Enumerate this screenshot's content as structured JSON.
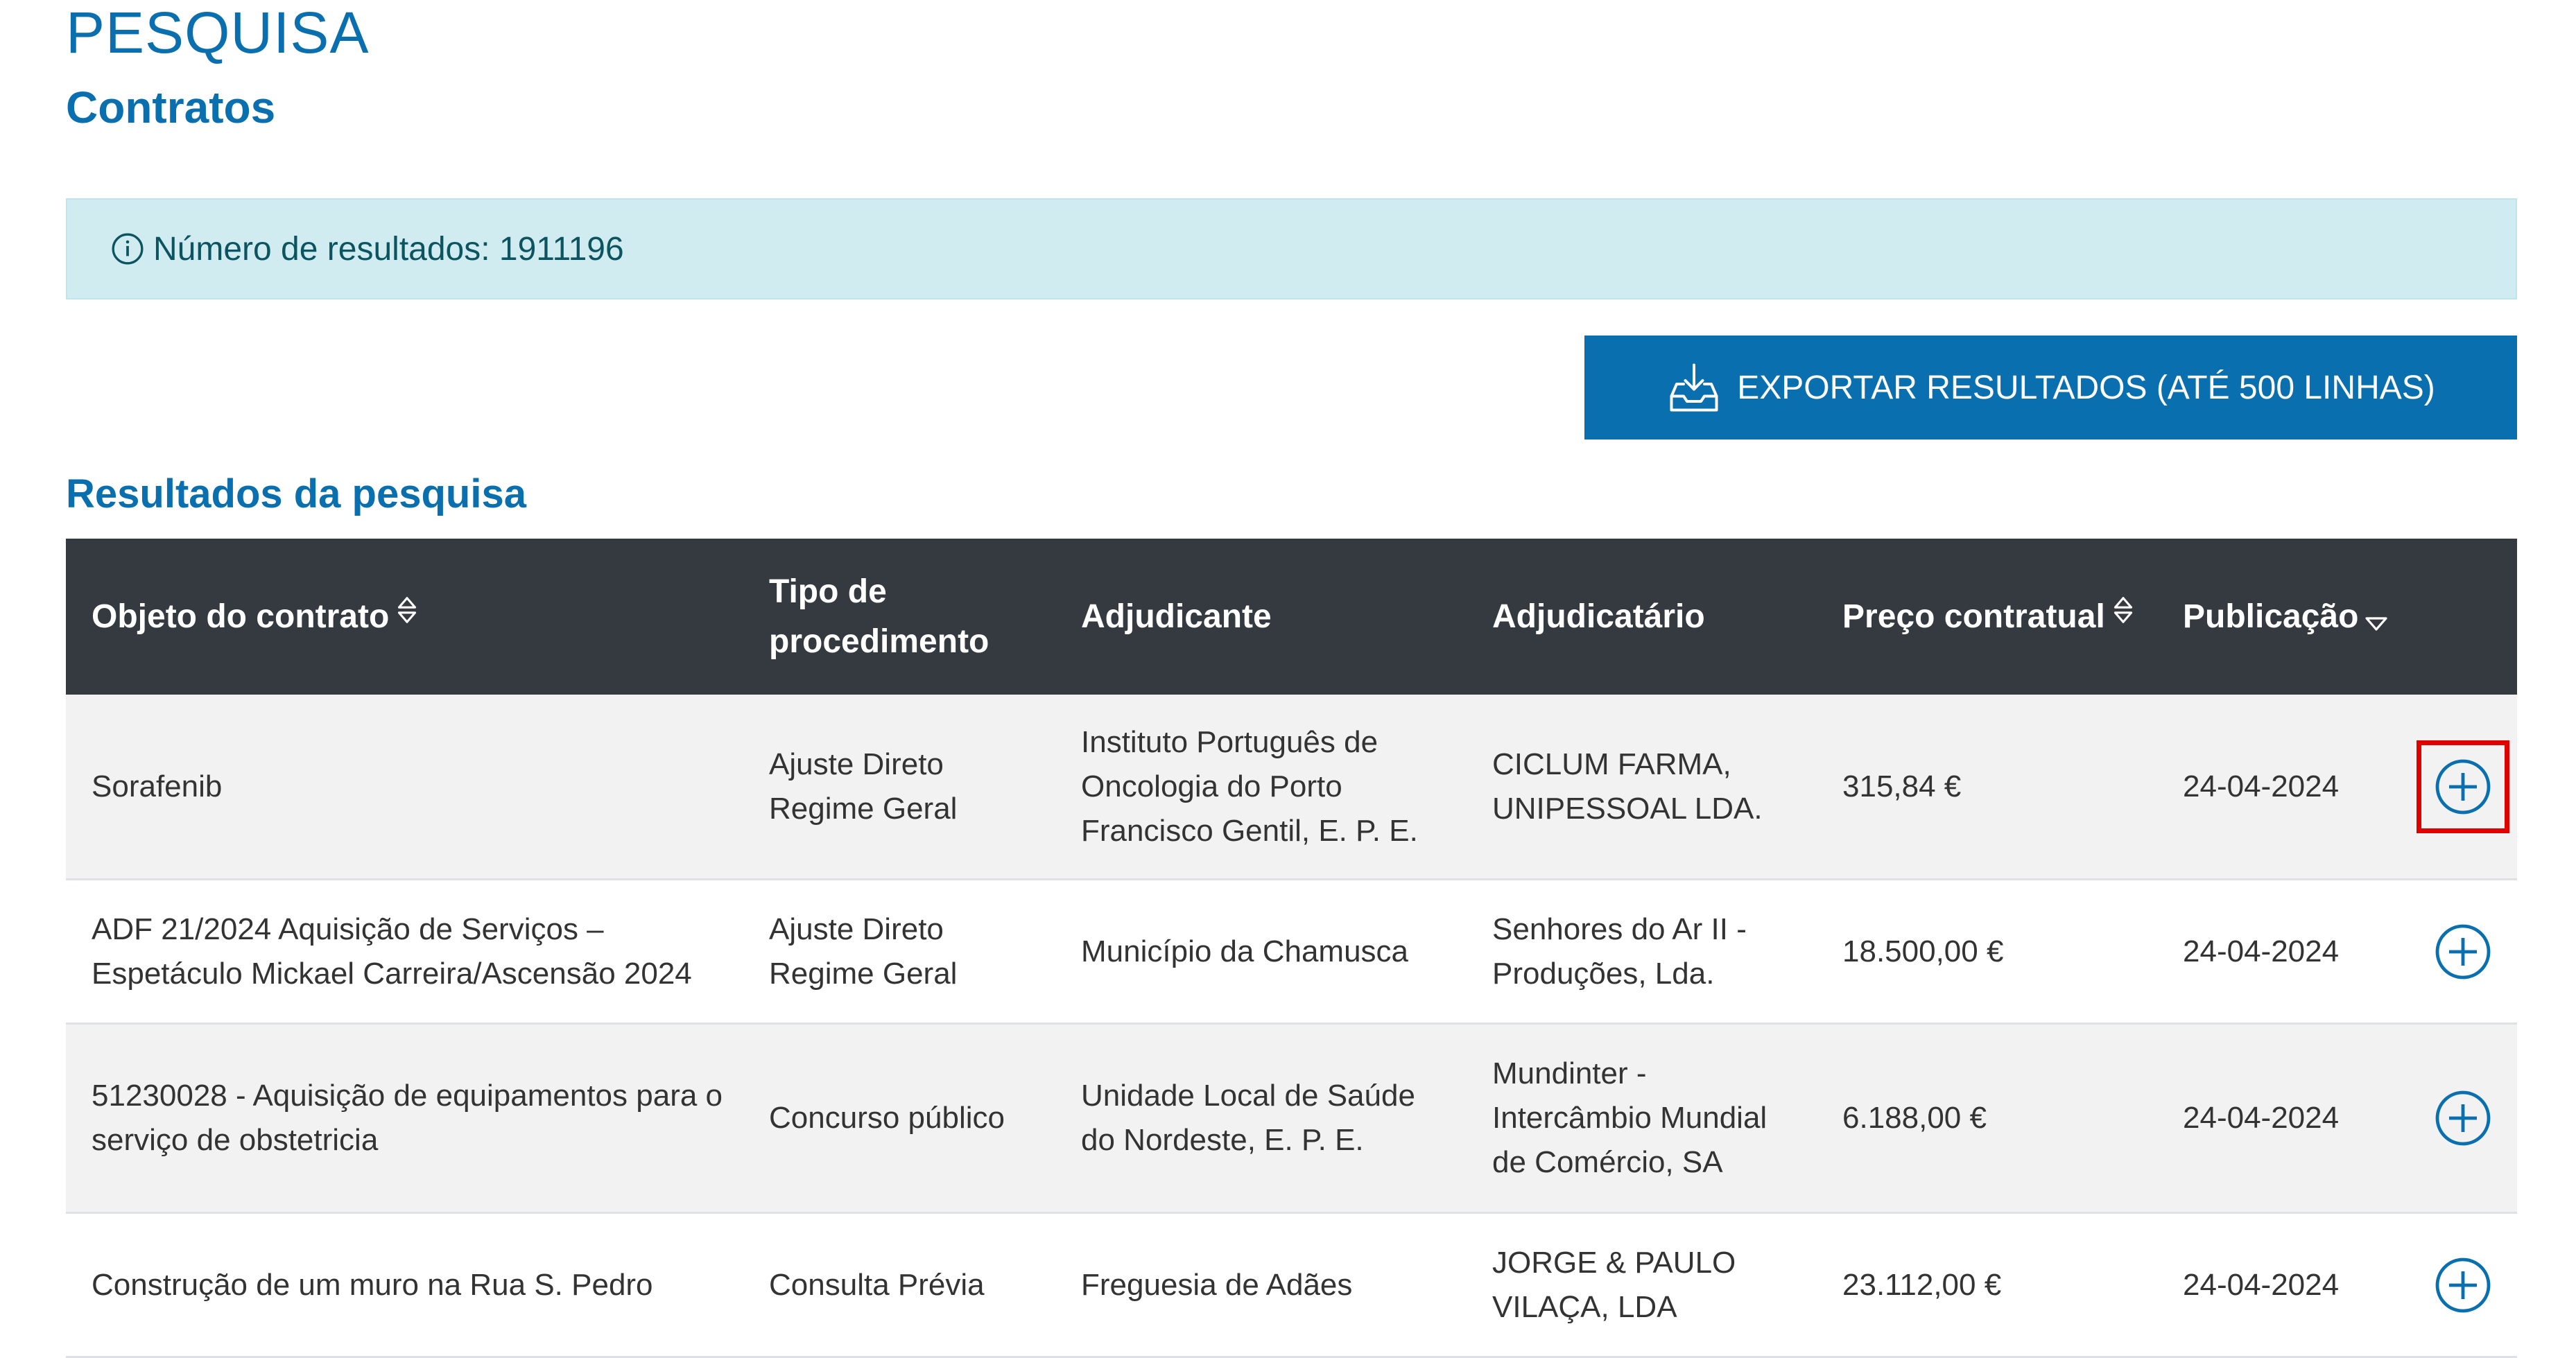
{
  "header": {
    "title": "PESQUISA",
    "subtitle": "Contratos"
  },
  "info": {
    "text": "Número de resultados: 1911196"
  },
  "export": {
    "label": "EXPORTAR RESULTADOS (ATÉ 500 LINHAS)"
  },
  "results": {
    "title": "Resultados da pesquisa",
    "columns": [
      "Objeto do contrato",
      "Tipo de procedimento",
      "Adjudicante",
      "Adjudicatário",
      "Preço contratual",
      "Publicação"
    ],
    "rows": [
      {
        "objeto": "Sorafenib",
        "tipo": "Ajuste Direto Regime Geral",
        "adjudicante": "Instituto Português de Oncologia do Porto Francisco Gentil, E. P. E.",
        "adjudicatario": "CICLUM FARMA, UNIPESSOAL LDA.",
        "preco": "315,84 €",
        "publicacao": "24-04-2024"
      },
      {
        "objeto": "ADF 21/2024 Aquisição de Serviços – Espetáculo Mickael Carreira/Ascensão 2024",
        "tipo": "Ajuste Direto Regime Geral",
        "adjudicante": "Município da Chamusca",
        "adjudicatario": "Senhores do Ar II - Produções, Lda.",
        "preco": "18.500,00 €",
        "publicacao": "24-04-2024"
      },
      {
        "objeto": "51230028 - Aquisição de equipamentos para o serviço de obstetricia",
        "tipo": "Concurso público",
        "adjudicante": "Unidade Local de Saúde do Nordeste, E. P. E.",
        "adjudicatario": "Mundinter - Intercâmbio Mundial de Comércio, SA",
        "preco": "6.188,00 €",
        "publicacao": "24-04-2024"
      },
      {
        "objeto": "Construção de um muro na Rua S. Pedro",
        "tipo": "Consulta Prévia",
        "adjudicante": "Freguesia de Adães",
        "adjudicatario": "JORGE & PAULO VILAÇA, LDA",
        "preco": "23.112,00 €",
        "publicacao": "24-04-2024"
      }
    ]
  },
  "colors": {
    "brand": "#0a6fae",
    "header_bg": "#343a40",
    "info_bg": "#d1ecf1",
    "highlight": "#e00000"
  }
}
